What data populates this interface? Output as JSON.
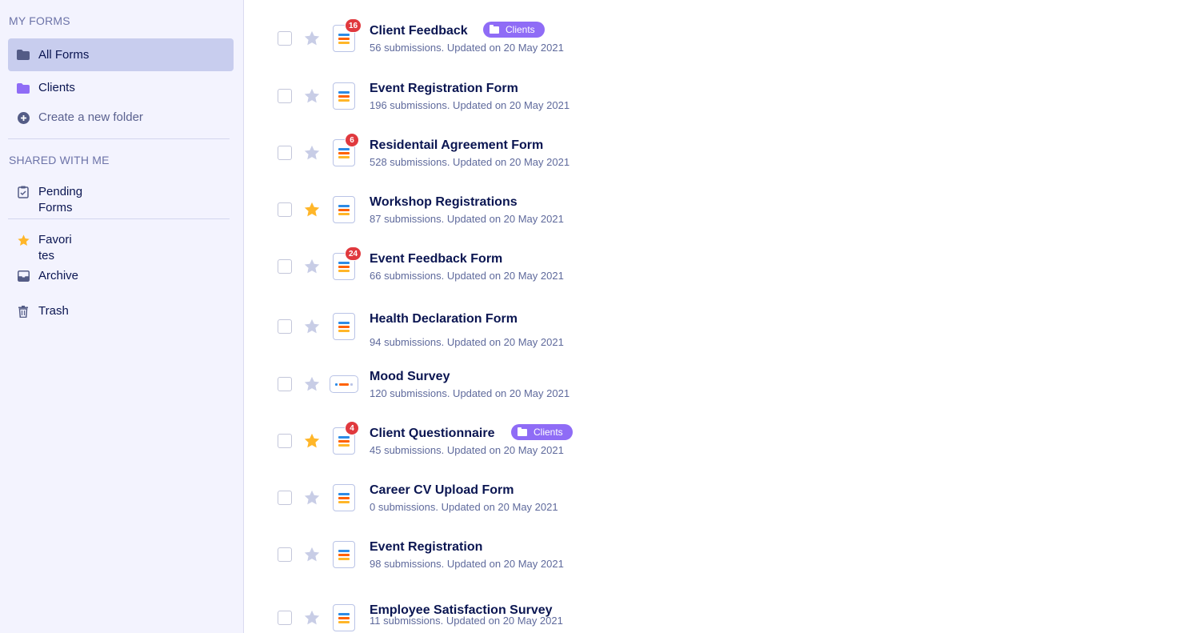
{
  "sidebar": {
    "my_forms_label": "MY FORMS",
    "all_forms": "All Forms",
    "clients": "Clients",
    "create_folder": "Create a new folder",
    "shared_label": "SHARED WITH ME",
    "pending_line1": "Pending",
    "pending_line2": "Forms",
    "favorites_line1": "Favori",
    "favorites_line2": "tes",
    "archive": "Archive",
    "trash": "Trash"
  },
  "forms": [
    {
      "title": "Client Feedback",
      "meta": "56 submissions. Updated on 20 May 2021",
      "badge": "16",
      "starred": false,
      "tag": "Clients"
    },
    {
      "title": "Event Registration Form",
      "meta": "196 submissions. Updated on 20 May 2021",
      "badge": "",
      "starred": false,
      "tag": ""
    },
    {
      "title": "Residentail Agreement Form",
      "meta": "528 submissions. Updated on 20 May 2021",
      "badge": "6",
      "starred": false,
      "tag": ""
    },
    {
      "title": "Workshop Registrations",
      "meta": "87 submissions. Updated on 20 May 2021",
      "badge": "",
      "starred": true,
      "tag": ""
    },
    {
      "title": "Event Feedback Form",
      "meta": "66 submissions. Updated on 20 May 2021",
      "badge": "24",
      "starred": false,
      "tag": ""
    },
    {
      "title": "Health Declaration Form",
      "meta": "94 submissions. Updated on 20 May 2021",
      "badge": "",
      "starred": false,
      "tag": ""
    },
    {
      "title": "Mood Survey",
      "meta": "120 submissions. Updated on 20 May 2021",
      "badge": "",
      "starred": false,
      "tag": ""
    },
    {
      "title": "Client Questionnaire",
      "meta": "45 submissions. Updated on 20 May 2021",
      "badge": "4",
      "starred": true,
      "tag": "Clients"
    },
    {
      "title": "Career CV Upload Form",
      "meta": "0 submissions. Updated on 20 May 2021",
      "badge": "",
      "starred": false,
      "tag": ""
    },
    {
      "title": "Event Registration",
      "meta": "98 submissions. Updated on 20 May 2021",
      "badge": "",
      "starred": false,
      "tag": ""
    },
    {
      "title": "Employee Satisfaction Survey",
      "meta": "11 submissions. Updated on 20 May 2021",
      "badge": "",
      "starred": false,
      "tag": ""
    }
  ],
  "colors": {
    "star_on": "#ffb629",
    "star_off": "#c8cde6",
    "badge": "#e0393e",
    "tag": "#8f6cf6",
    "icon_lines": [
      "#2c8be6",
      "#ff6100",
      "#ffb629"
    ]
  }
}
